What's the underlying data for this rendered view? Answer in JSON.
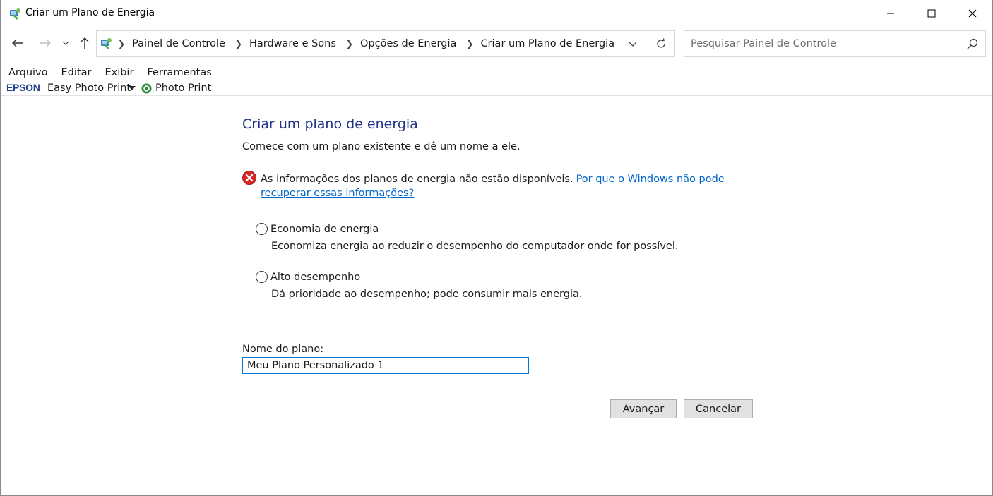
{
  "window": {
    "title": "Criar um Plano de Energia",
    "controls": {
      "minimize": "minimize-icon",
      "maximize": "maximize-icon",
      "close": "close-icon"
    }
  },
  "nav": {
    "breadcrumbs": [
      "Painel de Controle",
      "Hardware e Sons",
      "Opções de Energia",
      "Criar um Plano de Energia"
    ],
    "search_placeholder": "Pesquisar Painel de Controle"
  },
  "menu": {
    "items": [
      "Arquivo",
      "Editar",
      "Exibir",
      "Ferramentas"
    ]
  },
  "toolbar": {
    "epson_logo": "EPSON",
    "easy_photo_print": "Easy Photo Print",
    "photo_print": "Photo Print"
  },
  "main": {
    "heading": "Criar um plano de energia",
    "subheading": "Comece com um plano existente e dê um nome a ele.",
    "error_message": "As informações dos planos de energia não estão disponíveis.",
    "error_link": "Por que o Windows não pode recuperar essas informações?",
    "plans": [
      {
        "label": "Economia de energia",
        "description": "Economiza energia ao reduzir o desempenho do computador onde for possível."
      },
      {
        "label": "Alto desempenho",
        "description": "Dá prioridade ao desempenho; pode consumir mais energia."
      }
    ],
    "plan_name_label": "Nome do plano:",
    "plan_name_value": "Meu Plano Personalizado 1"
  },
  "buttons": {
    "next": "Avançar",
    "cancel": "Cancelar"
  },
  "colors": {
    "heading": "#1e3287",
    "link": "#0066cc",
    "error": "#d62a2a",
    "focus": "#0078d7"
  }
}
